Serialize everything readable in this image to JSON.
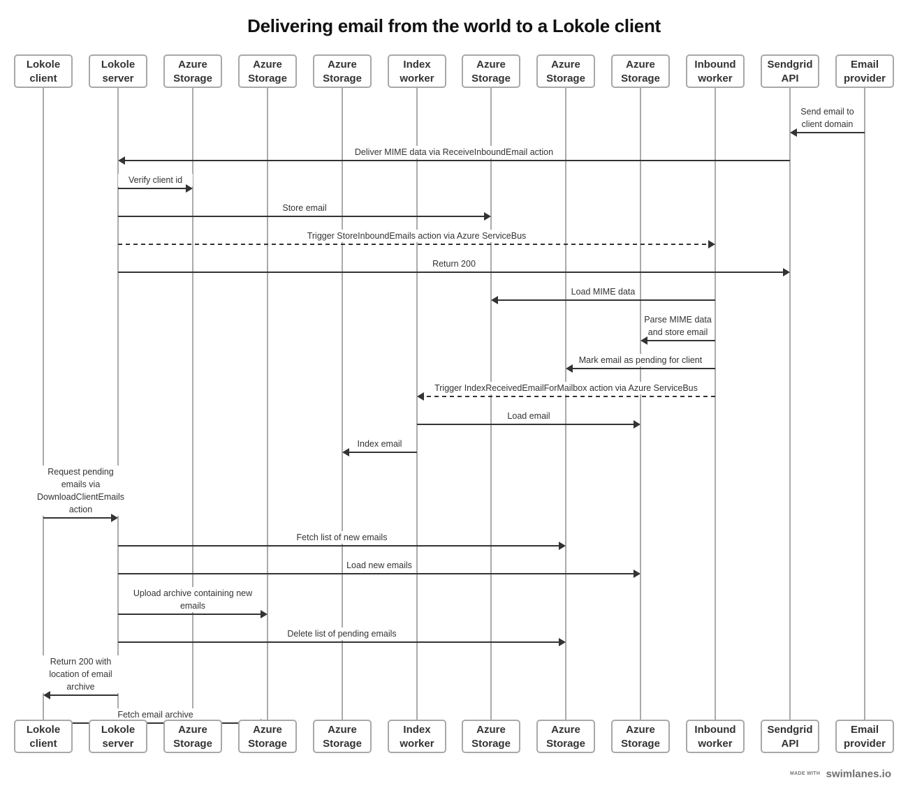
{
  "title": "Delivering email from the world to a Lokole client",
  "footer": {
    "prefix": "MADE WITH",
    "brand": "swimlanes.io"
  },
  "actors": [
    {
      "id": "lokole-client",
      "lines": [
        "Lokole",
        "client"
      ]
    },
    {
      "id": "lokole-server",
      "lines": [
        "Lokole",
        "server"
      ]
    },
    {
      "id": "azure-storage-1",
      "lines": [
        "Azure",
        "Storage"
      ]
    },
    {
      "id": "azure-storage-2",
      "lines": [
        "Azure",
        "Storage"
      ]
    },
    {
      "id": "azure-storage-3",
      "lines": [
        "Azure",
        "Storage"
      ]
    },
    {
      "id": "index-worker",
      "lines": [
        "Index",
        "worker"
      ]
    },
    {
      "id": "azure-storage-4",
      "lines": [
        "Azure",
        "Storage"
      ]
    },
    {
      "id": "azure-storage-5",
      "lines": [
        "Azure",
        "Storage"
      ]
    },
    {
      "id": "azure-storage-6",
      "lines": [
        "Azure",
        "Storage"
      ]
    },
    {
      "id": "inbound-worker",
      "lines": [
        "Inbound",
        "worker"
      ]
    },
    {
      "id": "sendgrid-api",
      "lines": [
        "Sendgrid",
        "API"
      ]
    },
    {
      "id": "email-provider",
      "lines": [
        "Email",
        "provider"
      ]
    }
  ],
  "messages": [
    {
      "from": 11,
      "to": 10,
      "style": "solid",
      "label": [
        "Send email to",
        "client domain"
      ]
    },
    {
      "from": 10,
      "to": 1,
      "style": "solid",
      "label": [
        "Deliver MIME data via ReceiveInboundEmail action"
      ]
    },
    {
      "from": 1,
      "to": 2,
      "style": "solid",
      "label": [
        "Verify client id"
      ]
    },
    {
      "from": 1,
      "to": 6,
      "style": "solid",
      "label": [
        "Store email"
      ]
    },
    {
      "from": 1,
      "to": 9,
      "style": "dashed",
      "label": [
        "Trigger StoreInboundEmails action via Azure ServiceBus"
      ]
    },
    {
      "from": 1,
      "to": 10,
      "style": "solid",
      "label": [
        "Return 200"
      ]
    },
    {
      "from": 9,
      "to": 6,
      "style": "solid",
      "label": [
        "Load MIME data"
      ]
    },
    {
      "from": 9,
      "to": 8,
      "style": "solid",
      "label": [
        "Parse MIME data",
        "and store email"
      ]
    },
    {
      "from": 9,
      "to": 7,
      "style": "solid",
      "label": [
        "Mark email as pending for client"
      ]
    },
    {
      "from": 9,
      "to": 5,
      "style": "dashed",
      "label": [
        "Trigger IndexReceivedEmailForMailbox action via Azure ServiceBus"
      ]
    },
    {
      "from": 5,
      "to": 8,
      "style": "solid",
      "label": [
        "Load email"
      ]
    },
    {
      "from": 5,
      "to": 4,
      "style": "solid",
      "label": [
        "Index email"
      ]
    },
    {
      "from": 0,
      "to": 1,
      "style": "solid",
      "label": [
        "Request pending",
        "emails via",
        "DownloadClientEmails",
        "action"
      ]
    },
    {
      "from": 1,
      "to": 7,
      "style": "solid",
      "label": [
        "Fetch list of new emails"
      ]
    },
    {
      "from": 1,
      "to": 8,
      "style": "solid",
      "label": [
        "Load new emails"
      ]
    },
    {
      "from": 1,
      "to": 3,
      "style": "solid",
      "label": [
        "Upload archive containing new",
        "emails"
      ]
    },
    {
      "from": 1,
      "to": 7,
      "style": "solid",
      "label": [
        "Delete list of pending emails"
      ]
    },
    {
      "from": 1,
      "to": 0,
      "style": "solid",
      "label": [
        "Return 200 with",
        "location of email",
        "archive"
      ]
    },
    {
      "from": 0,
      "to": 3,
      "style": "solid",
      "label": [
        "Fetch email archive"
      ]
    }
  ]
}
